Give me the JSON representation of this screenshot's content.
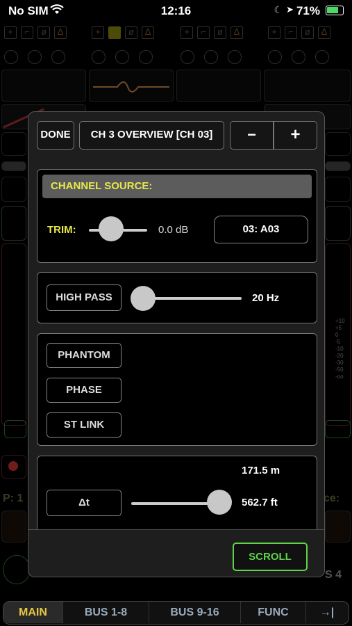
{
  "status_bar": {
    "carrier": "No SIM",
    "time": "12:16",
    "battery": "71%"
  },
  "background": {
    "left_edge_label": "P: 1",
    "right_edge_label": "ce:",
    "right_bus_label": "S 4",
    "meter_scale": [
      "+10",
      "+5",
      "0",
      "-5",
      "-10",
      "-20",
      "-30",
      "-50",
      "-oo"
    ]
  },
  "modal": {
    "done_label": "DONE",
    "title": "CH 3 OVERVIEW [CH 03]",
    "minus_label": "−",
    "plus_label": "+",
    "source": {
      "heading": "CHANNEL SOURCE:",
      "trim_label": "TRIM:",
      "trim_value": "0.0 dB",
      "input_name": "03: A03"
    },
    "highpass": {
      "button_label": "HIGH PASS",
      "value": "20 Hz"
    },
    "toggles": [
      "PHANTOM",
      "PHASE",
      "ST LINK"
    ],
    "delay": {
      "button_label": "Δt",
      "meters": "171.5 m",
      "feet": "562.7 ft"
    },
    "scroll_label": "SCROLL"
  },
  "tabbar": {
    "tabs": [
      "MAIN",
      "BUS 1-8",
      "BUS 9-16",
      "FUNC",
      "→|"
    ]
  },
  "colors": {
    "accent_yellow": "#e8e84a",
    "scroll_green": "#5fd34a",
    "tab_active": "#e8c840"
  }
}
